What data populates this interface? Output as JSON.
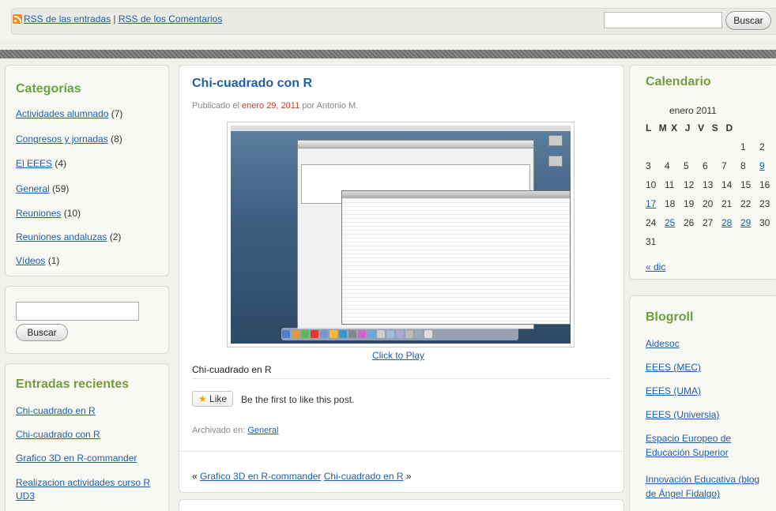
{
  "header": {
    "rss_posts": "RSS de las entradas",
    "rss_separator": "|",
    "rss_comments": "RSS de los Comentarios",
    "search_button": "Buscar"
  },
  "sidebar_left": {
    "categories_title": "Categorías",
    "categories": [
      {
        "label": "Actividades alumnado",
        "count": "(7)"
      },
      {
        "label": "Congresos y jornadas",
        "count": "(8)"
      },
      {
        "label": "El EEES",
        "count": "(4)"
      },
      {
        "label": "General",
        "count": "(59)"
      },
      {
        "label": "Reuniones",
        "count": "(10)"
      },
      {
        "label": "Reuniones andaluzas",
        "count": "(2)"
      },
      {
        "label": "Vídeos",
        "count": "(1)"
      }
    ],
    "search_button": "Buscar",
    "recent_title": "Entradas recientes",
    "recent": [
      "Chi-cuadrado en R",
      "Chi-cuadrado con R",
      "Grafico 3D en R-commander",
      "Realizacion actividades curso R UD3"
    ]
  },
  "post": {
    "title": "Chi-cuadrado con R",
    "meta_prefix": "Publicado el",
    "date": "enero 29, 2011",
    "meta_by": "por Antonio M.",
    "click_to_play": "Click to Play",
    "caption": "Chi-cuadrado en R",
    "like_label": "Like",
    "like_text": "Be the first to like this post.",
    "archived_prefix": "Archivado en:",
    "archived_category": "General",
    "nav_prev_arrow": "«",
    "nav_prev": "Grafico 3D en R-commander",
    "nav_next": "Chi-cuadrado en R",
    "nav_next_arrow": "»"
  },
  "calendar": {
    "title": "Calendario",
    "month": "enero 2011",
    "weekdays": "L  M X  J  V  S  D",
    "rows": [
      [
        "",
        "",
        "",
        "",
        "",
        "1",
        "2"
      ],
      [
        "3",
        "4",
        "5",
        "6",
        "7",
        "8",
        "9"
      ],
      [
        "10",
        "11",
        "12",
        "13",
        "14",
        "15",
        "16"
      ],
      [
        "17",
        "18",
        "19",
        "20",
        "21",
        "22",
        "23"
      ],
      [
        "24",
        "25",
        "26",
        "27",
        "28",
        "29",
        "30"
      ],
      [
        "31",
        "",
        "",
        "",
        "",
        "",
        ""
      ]
    ],
    "linked_days": [
      "9",
      "17",
      "25",
      "28",
      "29"
    ],
    "prev_link": "« dic"
  },
  "blogroll": {
    "title": "Blogroll",
    "items": [
      "Aidesoc",
      "EEES (MEC)",
      "EEES (UMA)",
      "EEES (Universia)",
      "Espacio Europeo de Educación Superior",
      "Innovación Educativa (blog de Ángel Fidalgo)"
    ]
  },
  "colors": {
    "accent_green": "#6f9f3c",
    "link_blue": "#1f5ea8",
    "date_red": "#c0392b",
    "rss_orange": "#f08a24"
  }
}
